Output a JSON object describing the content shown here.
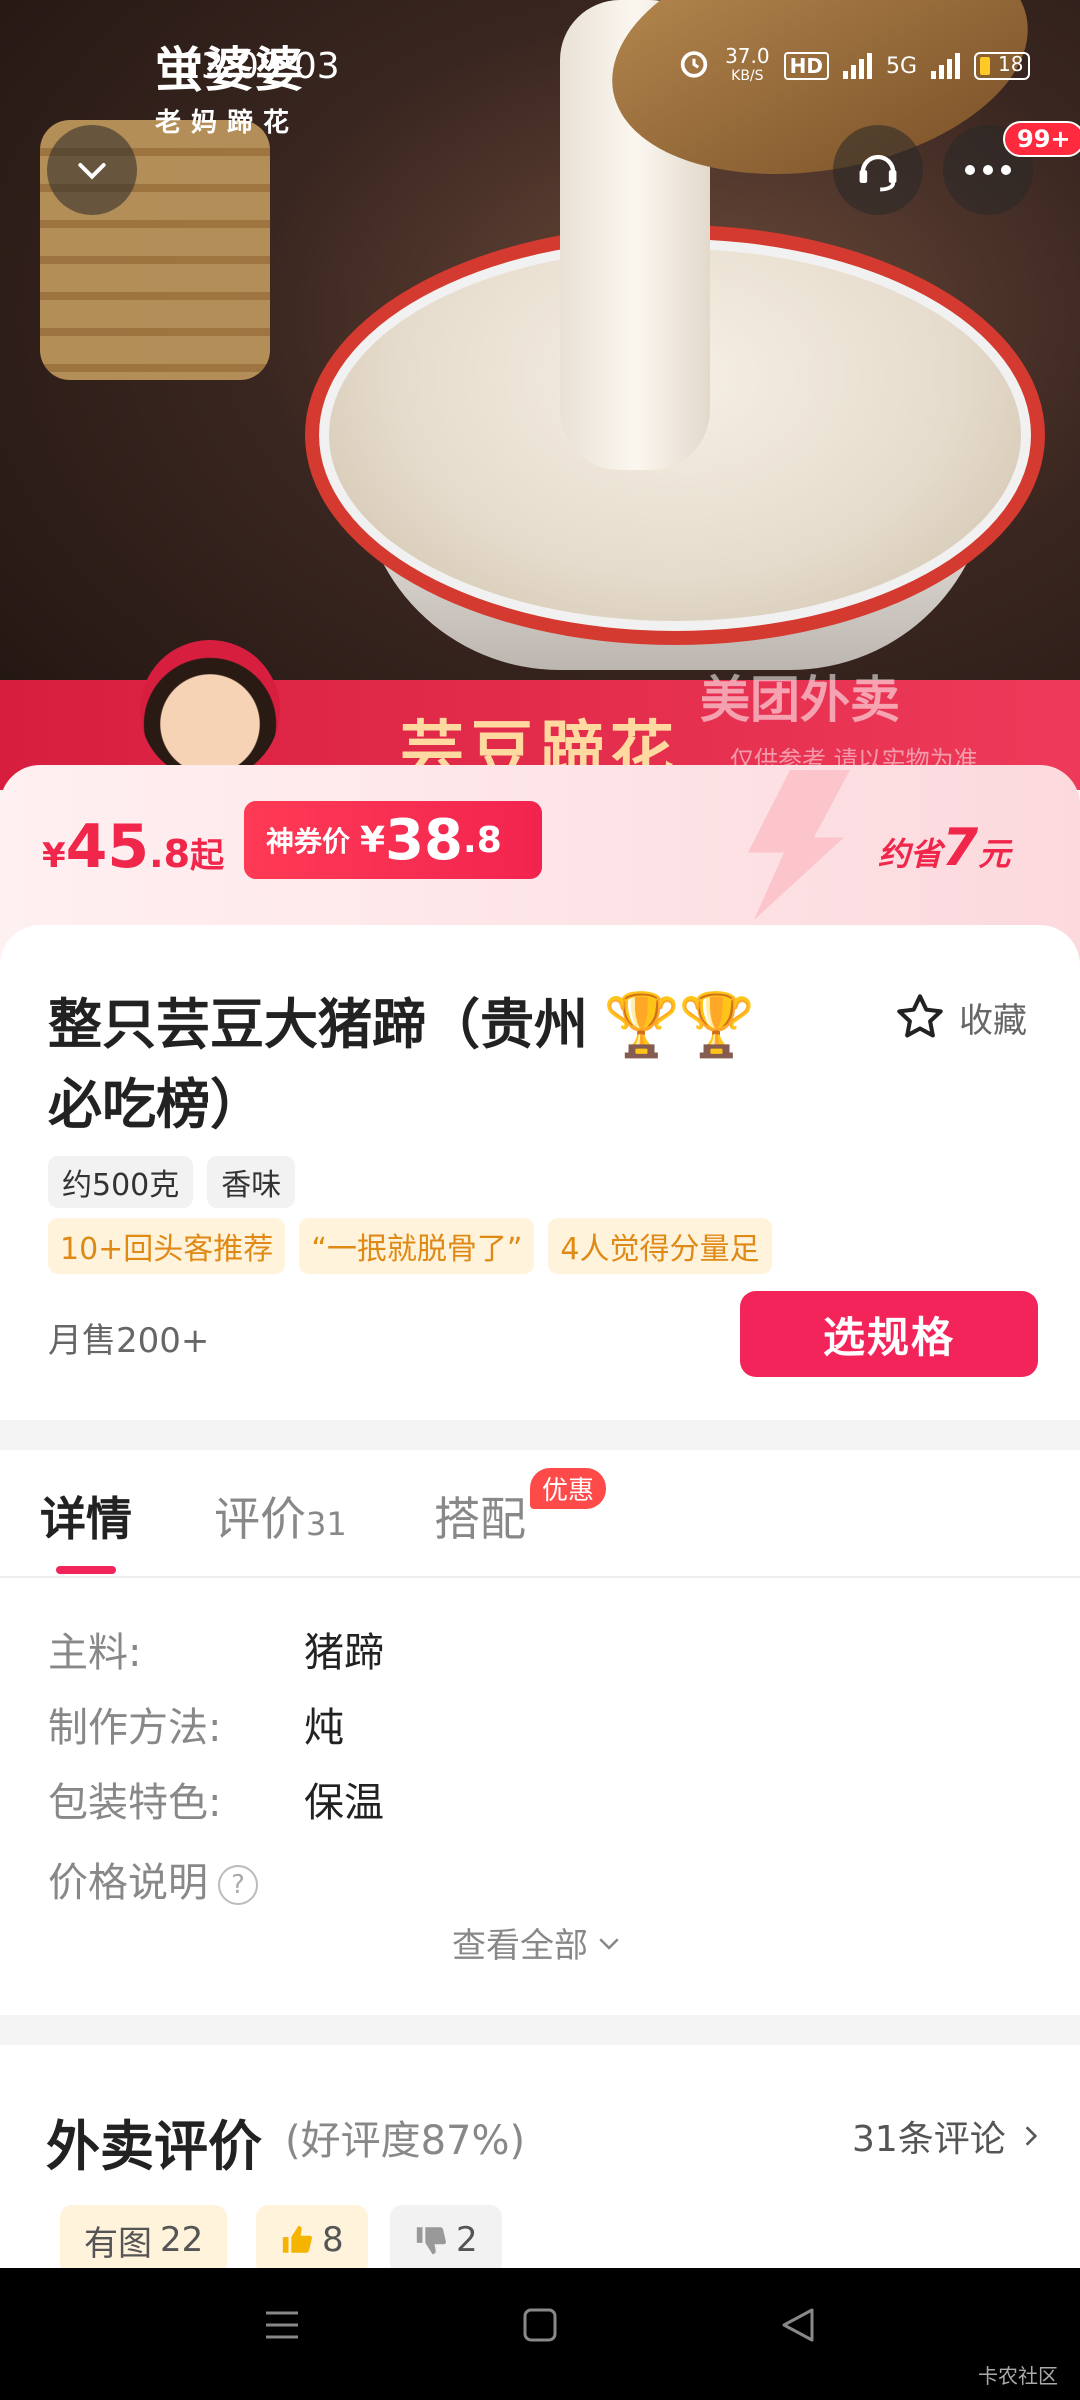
{
  "status_bar": {
    "time": "13:09:03",
    "net_speed_value": "37.0",
    "net_speed_unit": "KB/S",
    "hd_label": "HD",
    "network": "5G",
    "battery": "18"
  },
  "hero": {
    "brand_name": "蛍婆婆",
    "brand_sub": "老妈蹄花",
    "banner_text": "芸豆蹄花",
    "watermark": "美团外卖",
    "watermark_sub": "仅供参考 请以实物为准"
  },
  "header": {
    "notification_count": "99+"
  },
  "price": {
    "currency": "¥",
    "original_int": "45",
    "original_dec": ".8",
    "original_suffix": "起",
    "coupon_label": "神券价",
    "coupon_int": "38",
    "coupon_dec": ".8",
    "save_prefix": "约省",
    "save_value": "7",
    "save_unit": "元"
  },
  "product": {
    "title": "整只芸豆大猪蹄（贵州必吃榜）",
    "favorite_label": "收藏",
    "tags": [
      "约500克",
      "香味"
    ],
    "highlights": [
      "10+回头客推荐",
      "“一抿就脱骨了”",
      "4人觉得分量足"
    ],
    "monthly_sales": "月售200+",
    "select_spec_label": "选规格"
  },
  "tabs": {
    "details": "详情",
    "reviews": "评价",
    "reviews_count": "31",
    "combo": "搭配",
    "combo_badge": "优惠"
  },
  "details": {
    "rows": [
      {
        "label": "主料:",
        "value": "猪蹄"
      },
      {
        "label": "制作方法:",
        "value": "炖"
      },
      {
        "label": "包装特色:",
        "value": "保温"
      }
    ],
    "price_note": "价格说明",
    "see_all": "查看全部"
  },
  "reviews": {
    "title": "外卖评价",
    "rating": "(好评度87%)",
    "count_label": "31条评论",
    "chips": [
      {
        "label": "有图",
        "count": "22"
      },
      {
        "label": "",
        "count": "8"
      },
      {
        "label": "",
        "count": "2"
      }
    ]
  },
  "footer": {
    "watermark": "卡农社区"
  },
  "colors": {
    "accent": "#f2245a",
    "price_red": "#f0264b",
    "highlight_orange": "#e08a16"
  }
}
